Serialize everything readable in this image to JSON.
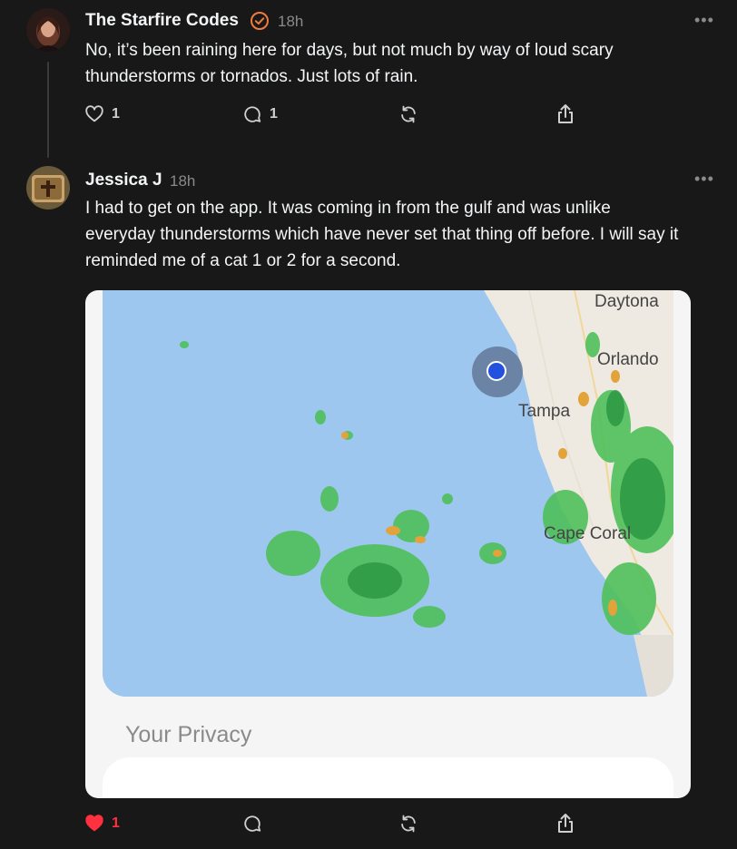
{
  "posts": [
    {
      "author": "The Starfire Codes",
      "time": "18h",
      "text_line1": "No, it’s been raining here for days, but not much by way of loud scary",
      "text_line2": "thunderstorms or tornados. Just lots of rain.",
      "likes": "1",
      "replies": "1",
      "verified_color": "#f27a3e"
    },
    {
      "author": "Jessica J",
      "time": "18h",
      "text_line1": "I had to get on the app. It was coming in from the gulf and was unlike",
      "text_line2": "everyday thunderstorms which have never set that thing off before. I will say it",
      "text_line3": "reminded me of a cat 1 or 2 for a second.",
      "likes": "1",
      "liked_color": "#ff3040"
    }
  ],
  "map": {
    "labels": [
      "Daytona",
      "Orlando",
      "Tampa",
      "Cape Coral"
    ],
    "location_dot_color": "#2450e0"
  },
  "privacy": {
    "title": "Your Privacy"
  },
  "more_label": "•••"
}
